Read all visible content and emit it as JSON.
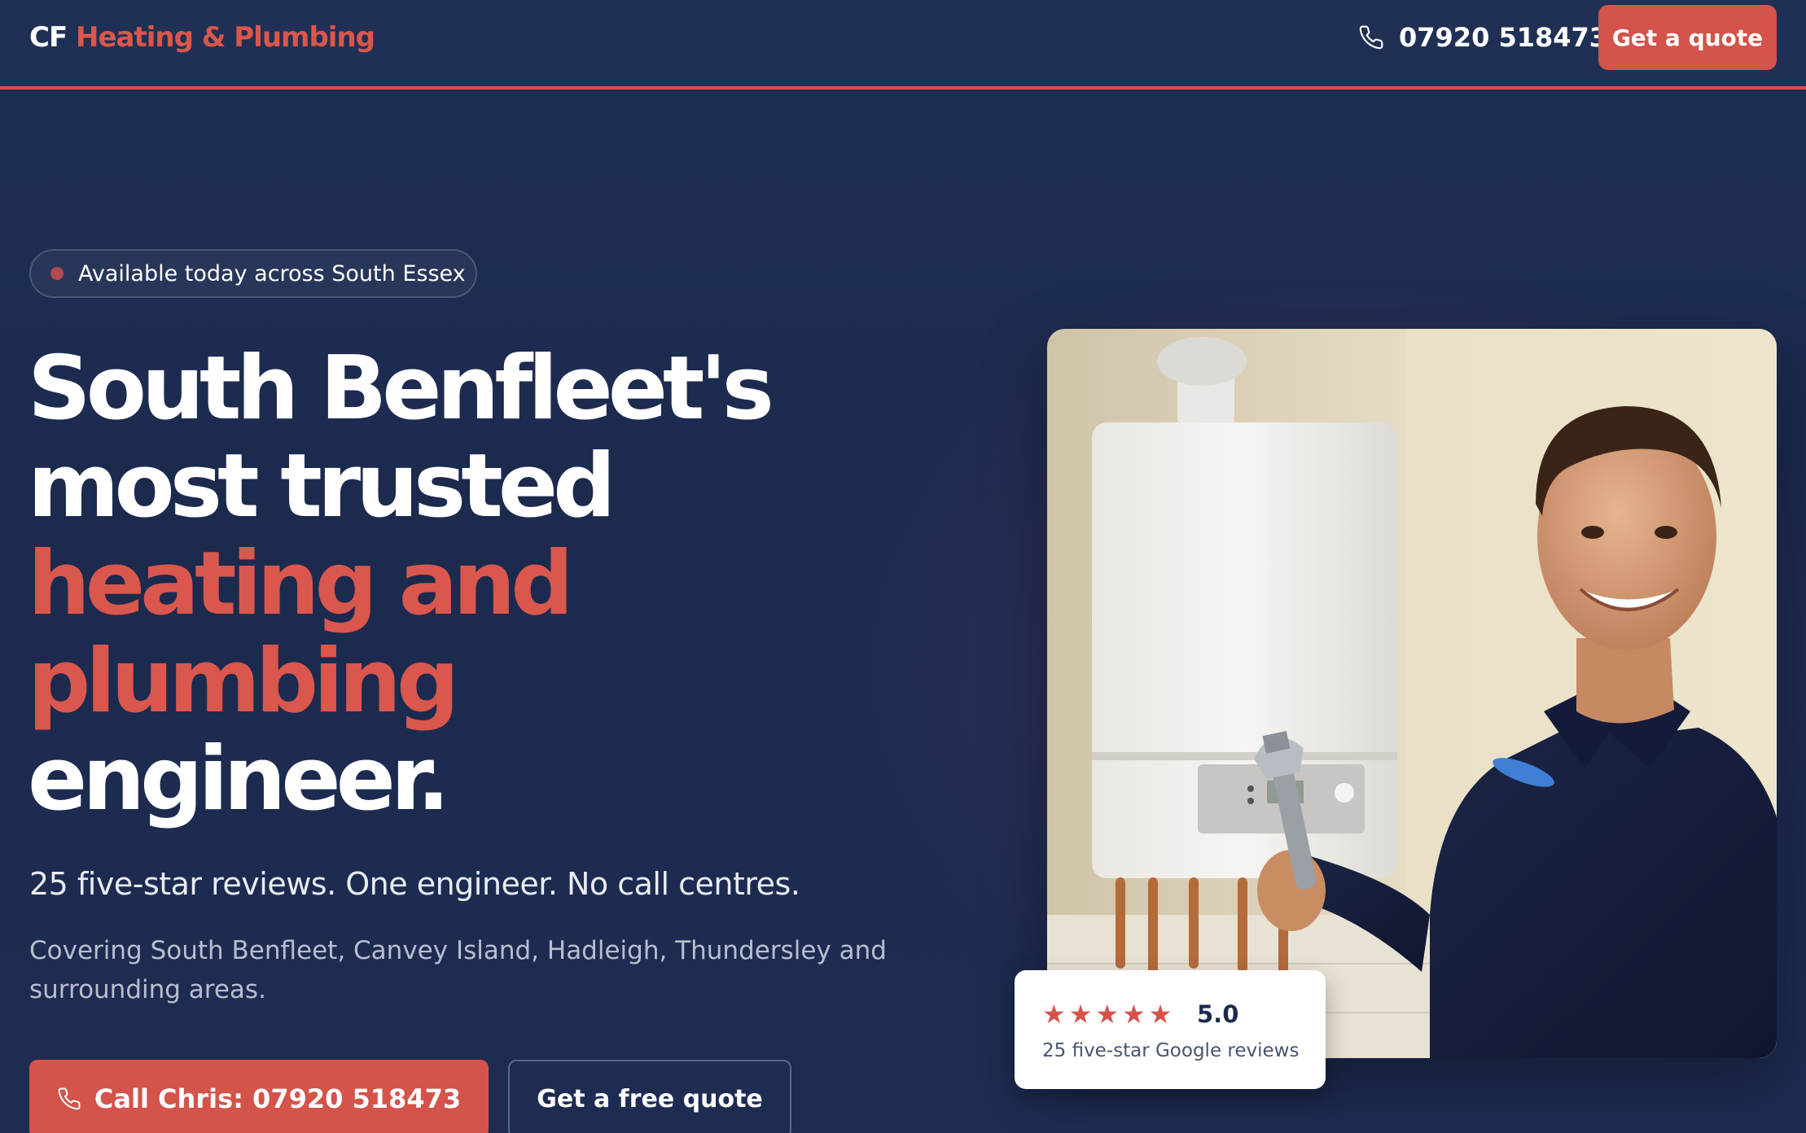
{
  "header": {
    "logo_prefix": "CF",
    "logo_name": "Heating & Plumbing",
    "phone": "07920 518473",
    "quote_button": "Get a quote"
  },
  "hero": {
    "badge": "Available today across South Essex",
    "title_lines": [
      {
        "text": "South Benfleet's",
        "accent": false
      },
      {
        "text": "most trusted",
        "accent": false
      },
      {
        "text": "heating and",
        "accent": true
      },
      {
        "text": "plumbing",
        "accent": true
      },
      {
        "text": "engineer.",
        "accent": false
      }
    ],
    "tagline": "25 five-star reviews. One engineer. No call centres.",
    "coverage": "Covering South Benfleet, Canvey Island, Hadleigh, Thundersley and surrounding areas.",
    "call_button": "Call Chris: 07920 518473",
    "free_quote_button": "Get a free quote"
  },
  "review_card": {
    "stars": 5,
    "rating": "5.0",
    "label": "25 five-star Google reviews"
  },
  "icons": {
    "phone": "phone-icon",
    "star": "star-icon",
    "status_dot": "status-dot"
  },
  "colors": {
    "accent": "#d4534a",
    "background": "#1c2a4d",
    "header": "#203055"
  }
}
